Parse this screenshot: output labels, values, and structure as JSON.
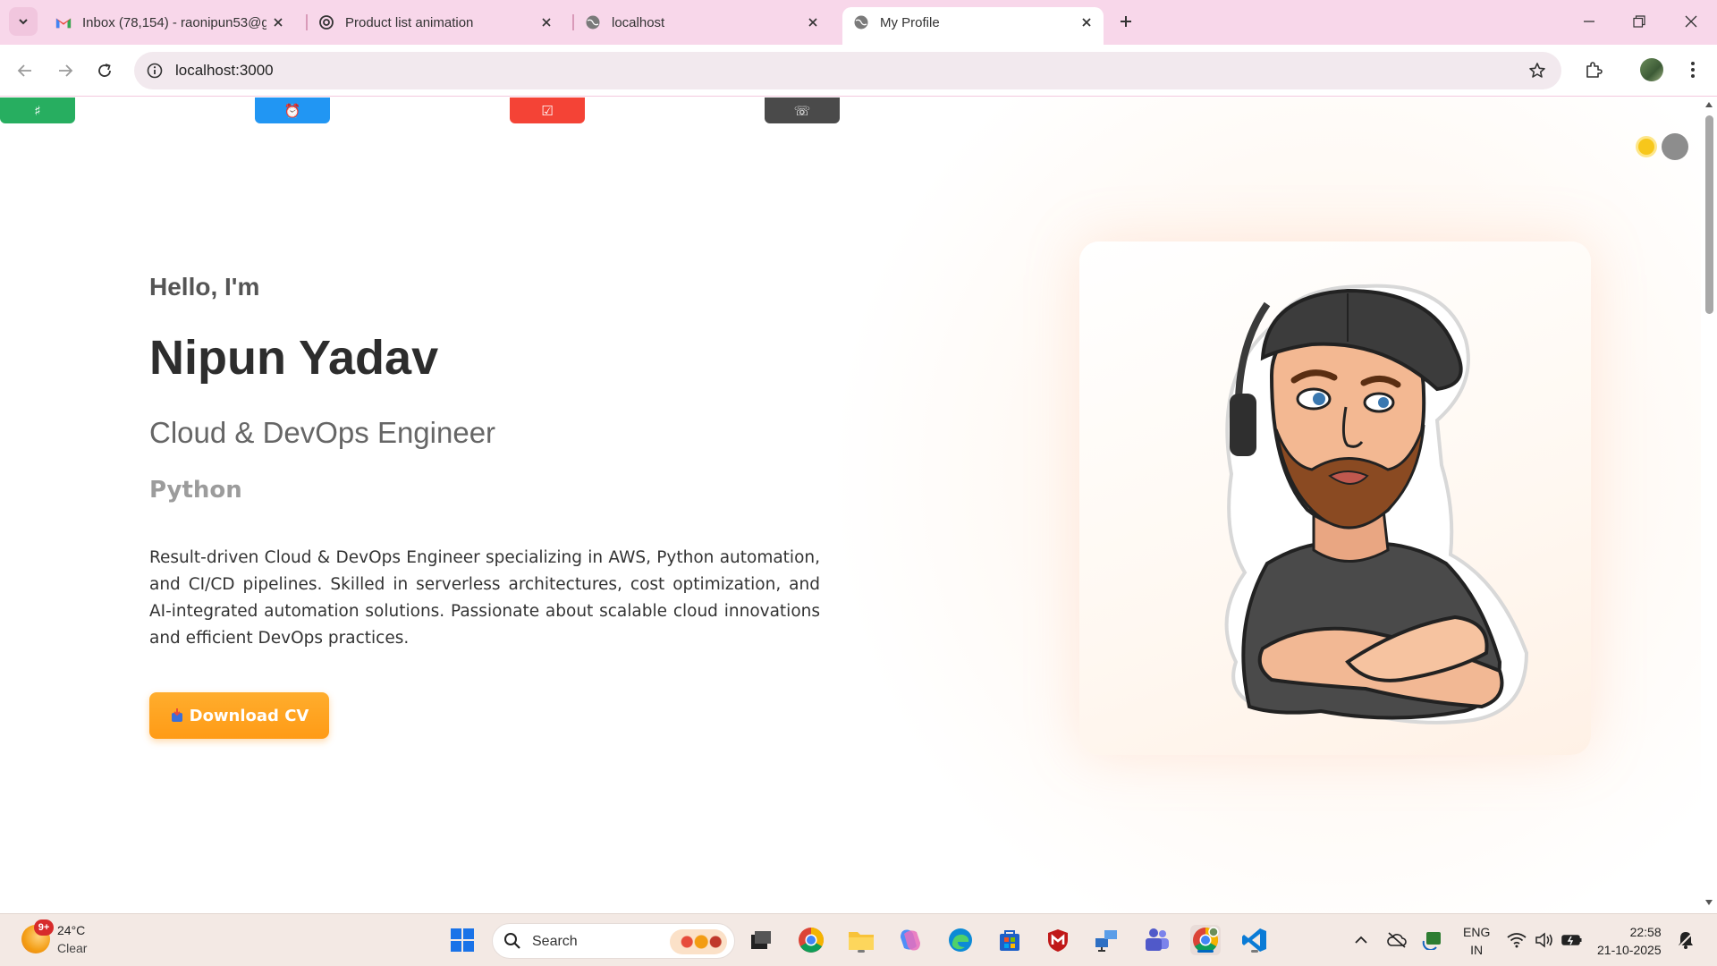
{
  "browser": {
    "tabs": [
      {
        "title": "Inbox (78,154) - raonipun53@g",
        "icon": "gmail-icon"
      },
      {
        "title": "Product list animation",
        "icon": "openai-icon"
      },
      {
        "title": "localhost",
        "icon": "globe-icon"
      },
      {
        "title": "My Profile",
        "icon": "globe-icon",
        "active": true
      }
    ],
    "url": "localhost:3000"
  },
  "page": {
    "top_nav_icons": [
      {
        "glyph": "♯",
        "color": "#27ae60"
      },
      {
        "glyph": "⏰",
        "color": "#2196f3"
      },
      {
        "glyph": "☑",
        "color": "#f44336"
      },
      {
        "glyph": "☏",
        "color": "#4a4a4a"
      }
    ],
    "hero": {
      "greeting": "Hello, I'm",
      "name": "Nipun Yadav",
      "role": "Cloud & DevOps Engineer",
      "skill": "Python",
      "bio": "Result-driven Cloud & DevOps Engineer specializing in AWS, Python automation, and CI/CD pipelines. Skilled in serverless architectures, cost optimization, and AI-integrated automation solutions. Passionate about scalable cloud innovations and efficient DevOps practices.",
      "download_label": "Download CV"
    },
    "accent_color": "#ff9f1c"
  },
  "taskbar": {
    "weather": {
      "badge": "9+",
      "temperature": "24°C",
      "condition": "Clear"
    },
    "search_label": "Search",
    "language": {
      "line1": "ENG",
      "line2": "IN"
    },
    "clock": {
      "time": "22:58",
      "date": "21-10-2025"
    }
  }
}
